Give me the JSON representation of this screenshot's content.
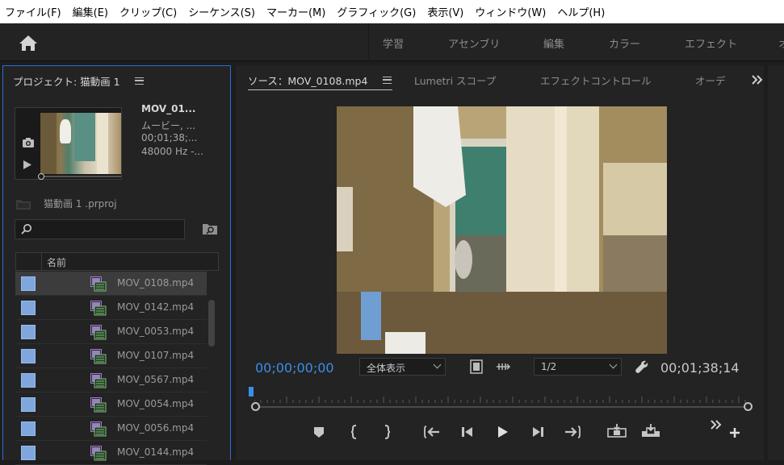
{
  "menu": [
    "ファイル(F)",
    "編集(E)",
    "クリップ(C)",
    "シーケンス(S)",
    "マーカー(M)",
    "グラフィック(G)",
    "表示(V)",
    "ウィンドウ(W)",
    "ヘルプ(H)"
  ],
  "workspace_tabs": [
    "学習",
    "アセンブリ",
    "編集",
    "カラー",
    "エフェクト",
    "オ"
  ],
  "project": {
    "title": "プロジェクト: 猫動画 1",
    "clip_name": "MOV_01...",
    "clip_type": "ムービー, ...",
    "clip_duration": "00;01;38;...",
    "clip_audio": "48000 Hz -...",
    "project_file": "猫動画 1 .prproj",
    "column_name": "名前",
    "files": [
      "MOV_0108.mp4",
      "MOV_0142.mp4",
      "MOV_0053.mp4",
      "MOV_0107.mp4",
      "MOV_0567.mp4",
      "MOV_0054.mp4",
      "MOV_0056.mp4",
      "MOV_0144.mp4"
    ],
    "selected_index": 0
  },
  "source": {
    "tabs": [
      "ソース：MOV_0108.mp4",
      "Lumetri スコープ",
      "エフェクトコントロール",
      "オーデ"
    ],
    "timecode_current": "00;00;00;00",
    "fit_option": "全体表示",
    "resolution": "1/2",
    "timecode_duration": "00;01;38;14"
  },
  "colors": {
    "accent": "#3b8ee8",
    "selected_chip": "#7fa7de",
    "clip_icon": "#9b7fc4"
  }
}
